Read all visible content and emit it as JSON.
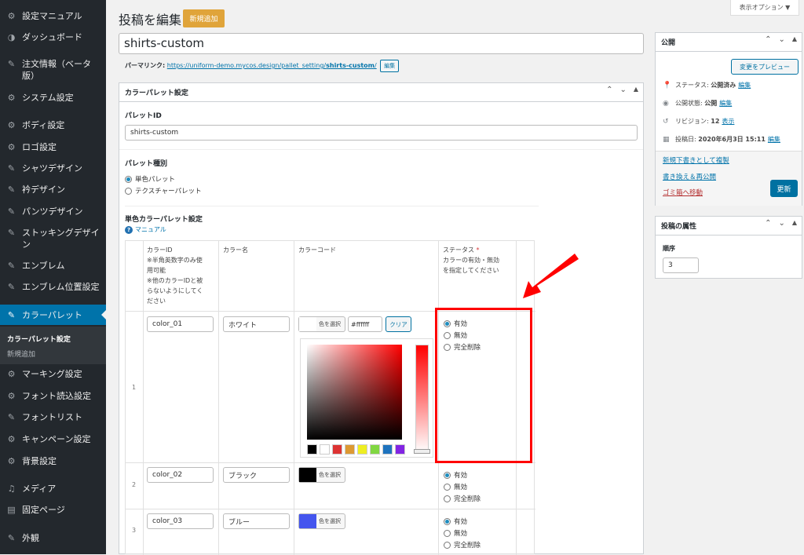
{
  "sidebar": {
    "items": [
      {
        "label": "設定マニュアル",
        "icon": "gear-icon",
        "glyph": "⚙"
      },
      {
        "label": "ダッシュボード",
        "icon": "dashboard-icon",
        "glyph": "◑"
      },
      {
        "label": "注文情報（ベータ版）",
        "icon": "pin-icon",
        "glyph": "✎"
      },
      {
        "label": "システム設定",
        "icon": "gear-icon",
        "glyph": "⚙"
      },
      {
        "label": "ボディ設定",
        "icon": "gear-icon",
        "glyph": "⚙"
      },
      {
        "label": "ロゴ設定",
        "icon": "gear-icon",
        "glyph": "⚙"
      },
      {
        "label": "シャツデザイン",
        "icon": "pin-icon",
        "glyph": "✎"
      },
      {
        "label": "衿デザイン",
        "icon": "pin-icon",
        "glyph": "✎"
      },
      {
        "label": "パンツデザイン",
        "icon": "pin-icon",
        "glyph": "✎"
      },
      {
        "label": "ストッキングデザイン",
        "icon": "pin-icon",
        "glyph": "✎"
      },
      {
        "label": "エンブレム",
        "icon": "pin-icon",
        "glyph": "✎"
      },
      {
        "label": "エンブレム位置設定",
        "icon": "pin-icon",
        "glyph": "✎"
      },
      {
        "label": "カラーパレット",
        "icon": "pin-icon",
        "glyph": "✎"
      },
      {
        "label": "マーキング設定",
        "icon": "gear-icon",
        "glyph": "⚙"
      },
      {
        "label": "フォント読込設定",
        "icon": "gear-icon",
        "glyph": "⚙"
      },
      {
        "label": "フォントリスト",
        "icon": "pin-icon",
        "glyph": "✎"
      },
      {
        "label": "キャンペーン設定",
        "icon": "gear-icon",
        "glyph": "⚙"
      },
      {
        "label": "背景設定",
        "icon": "gear-icon",
        "glyph": "⚙"
      },
      {
        "label": "メディア",
        "icon": "media-icon",
        "glyph": "♫"
      },
      {
        "label": "固定ページ",
        "icon": "page-icon",
        "glyph": "▤"
      },
      {
        "label": "外観",
        "icon": "brush-icon",
        "glyph": "✎"
      }
    ],
    "submenu": [
      "カラーパレット設定",
      "新規追加"
    ]
  },
  "screen_options": "表示オプション ▼",
  "header": {
    "title": "投稿を編集",
    "add_new": "新規追加"
  },
  "post_title": "shirts-custom",
  "permalink": {
    "label": "パーマリンク:",
    "url": "https://uniform-demo.mycos.design/pallet_setting/",
    "slug": "shirts-custom",
    "trail": "/",
    "edit": "編集"
  },
  "palette_box": {
    "title": "カラーパレット設定",
    "id_label": "パレットID",
    "id_value": "shirts-custom",
    "type_label": "パレット種別",
    "type_options": [
      "単色パレット",
      "テクスチャーパレット"
    ],
    "single_label": "単色カラーパレット設定",
    "manual": "マニュアル",
    "headers": {
      "id": [
        "カラーID",
        "※半角英数字のみ使",
        "用可能",
        "※他のカラーIDと被",
        "らないようにしてく",
        "ださい"
      ],
      "name": "カラー名",
      "code": "カラーコード",
      "status": [
        "ステータス",
        "カラーの有効・無効",
        "を指定してください"
      ],
      "required": "*"
    },
    "rows": [
      {
        "num": "1",
        "id": "color_01",
        "name": "ホワイト",
        "chip": "#ffffff",
        "hex": "#ffffff",
        "clear": "クリア"
      },
      {
        "num": "2",
        "id": "color_02",
        "name": "ブラック",
        "chip": "#000000"
      },
      {
        "num": "3",
        "id": "color_03",
        "name": "ブルー",
        "chip": "#4455ee"
      }
    ],
    "select_color": "色を選択",
    "status_options": [
      "有効",
      "無効",
      "完全削除"
    ],
    "swatches": [
      "#000000",
      "#ffffff",
      "#dd3333",
      "#dd9933",
      "#eeee22",
      "#81d742",
      "#1e73be",
      "#8224e3"
    ]
  },
  "publish_box": {
    "title": "公開",
    "preview": "変更をプレビュー",
    "status_label": "ステータス:",
    "status_value": "公開済み",
    "visibility_label": "公開状態:",
    "visibility_value": "公開",
    "revisions_label": "リビジョン:",
    "revisions_value": "12",
    "revisions_link": "表示",
    "date_label": "投稿日:",
    "date_value": "2020年6月3日 15:11",
    "edit": "編集",
    "copy_draft": "新規下書きとして複製",
    "rewrite": "書き換え＆再公開",
    "trash": "ゴミ箱へ移動",
    "update": "更新"
  },
  "attributes_box": {
    "title": "投稿の属性",
    "order_label": "順序",
    "order_value": "3"
  }
}
